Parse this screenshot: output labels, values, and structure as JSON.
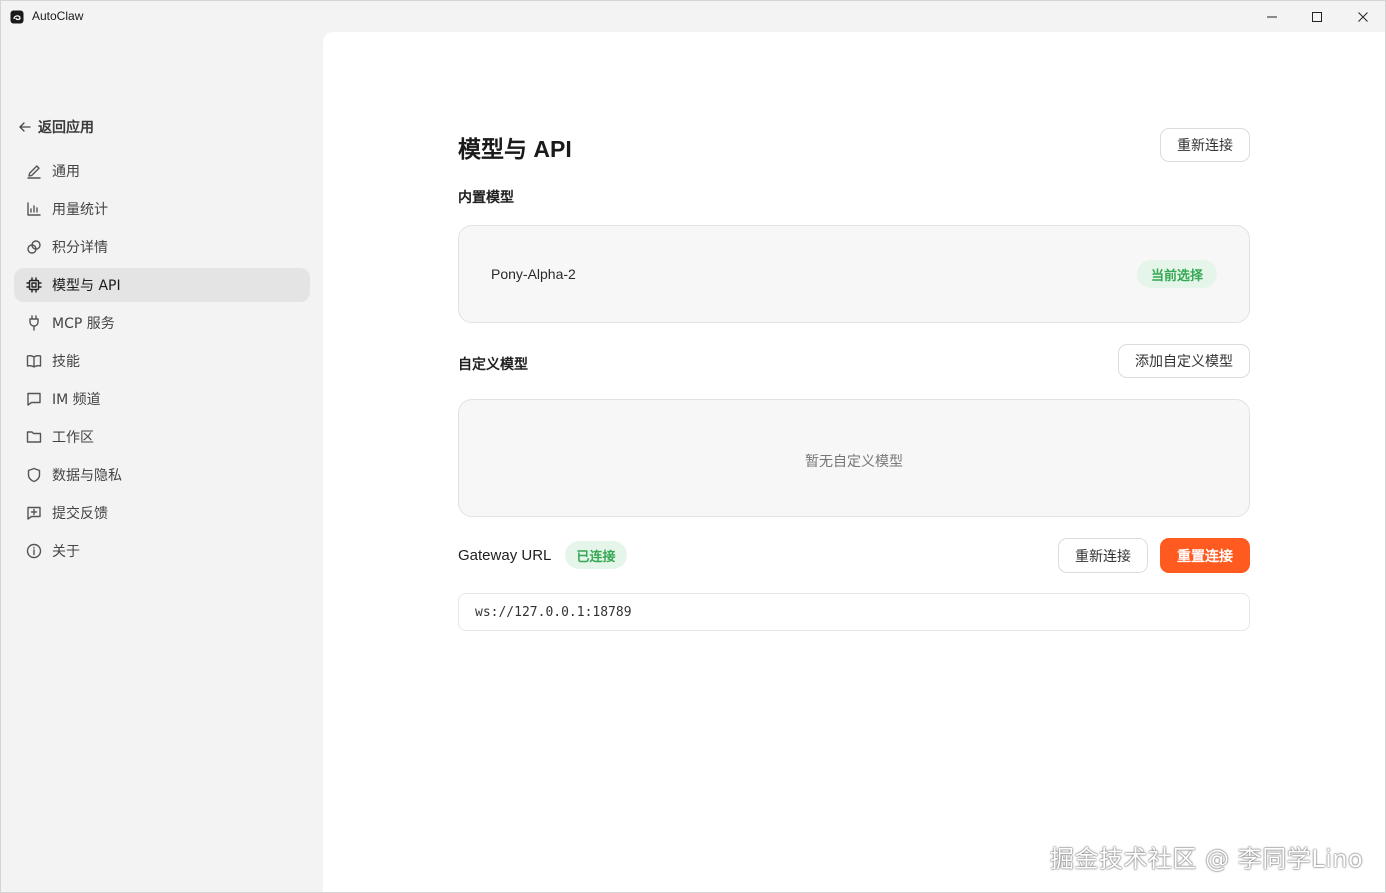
{
  "window": {
    "title": "AutoClaw"
  },
  "sidebar": {
    "back_label": "返回应用",
    "items": [
      {
        "label": "通用",
        "icon": "pencil-icon"
      },
      {
        "label": "用量统计",
        "icon": "bar-chart-icon"
      },
      {
        "label": "积分详情",
        "icon": "coins-icon"
      },
      {
        "label": "模型与 API",
        "icon": "chip-icon",
        "active": true
      },
      {
        "label": "MCP 服务",
        "icon": "plug-icon"
      },
      {
        "label": "技能",
        "icon": "book-icon"
      },
      {
        "label": "IM 频道",
        "icon": "message-icon"
      },
      {
        "label": "工作区",
        "icon": "folder-icon"
      },
      {
        "label": "数据与隐私",
        "icon": "shield-icon"
      },
      {
        "label": "提交反馈",
        "icon": "feedback-icon"
      },
      {
        "label": "关于",
        "icon": "info-icon"
      }
    ]
  },
  "main": {
    "title": "模型与 API",
    "reconnect_top_label": "重新连接",
    "builtin": {
      "heading": "内置模型",
      "model_name": "Pony-Alpha-2",
      "badge": "当前选择"
    },
    "custom": {
      "heading": "自定义模型",
      "add_label": "添加自定义模型",
      "empty_text": "暂无自定义模型"
    },
    "gateway": {
      "label": "Gateway URL",
      "status": "已连接",
      "reconnect_label": "重新连接",
      "reset_label": "重置连接",
      "url": "ws://127.0.0.1:18789"
    }
  },
  "watermark": "掘金技术社区 @ 李同学Lino",
  "colors": {
    "accent": "#ff5a1f",
    "success_text": "#34a853",
    "success_bg": "#e6f5ea",
    "active_nav_bg": "#e4e4e4"
  }
}
